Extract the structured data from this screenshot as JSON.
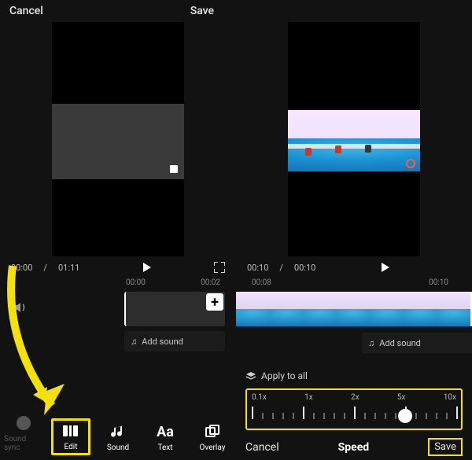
{
  "left": {
    "header": {
      "cancel": "Cancel",
      "save": "Save"
    },
    "transport": {
      "current": "00:00",
      "total": "01:11"
    },
    "ruler": [
      "00:00",
      "00:02"
    ],
    "add_sound": "Add sound",
    "toolbar": {
      "sound_sync": "Sound sync",
      "edit": "Edit",
      "sound": "Sound",
      "text": "Text",
      "overlay": "Overlay",
      "text_glyph": "Aa"
    }
  },
  "right": {
    "transport": {
      "current": "00:10",
      "total": "00:10"
    },
    "ruler": [
      "00:08",
      "00:10"
    ],
    "add_sound": "Add sound",
    "speed_panel": {
      "apply_all": "Apply to all",
      "labels": [
        "0.1x",
        "1x",
        "2x",
        "5x",
        "10x"
      ],
      "value_index": 3,
      "cancel": "Cancel",
      "title": "Speed",
      "save": "Save"
    }
  },
  "icons": {
    "plus": "+",
    "music_note": "♫"
  }
}
